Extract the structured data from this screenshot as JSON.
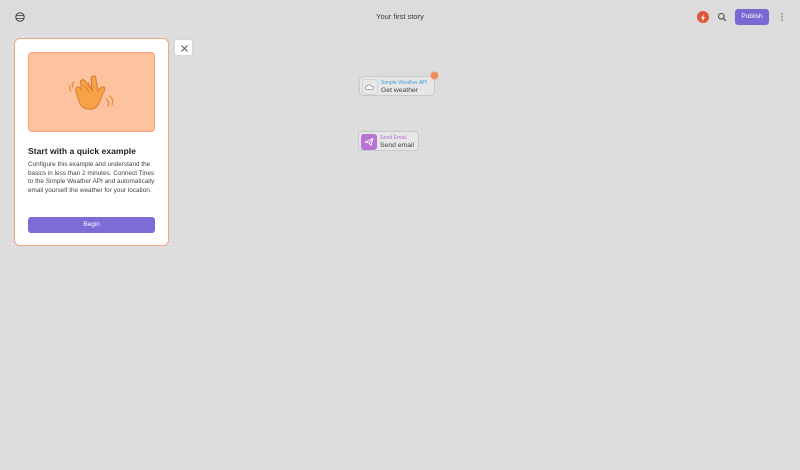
{
  "header": {
    "story_title": "Your first story",
    "publish_label": "Publish"
  },
  "modal": {
    "title": "Start with a quick example",
    "body": "Configure this example and understand the basics in less than 2 minutes. Connect Tines to the Simple Weather API and automatically email yourself the weather for your location.",
    "begin_label": "Begin",
    "hero_icon": "waving-hand-icon"
  },
  "nodes": [
    {
      "type": "Simple Weather API",
      "name": "Get weather",
      "icon": "cloud-icon"
    },
    {
      "type": "Send Email",
      "name": "Send email",
      "icon": "paper-plane-icon"
    }
  ],
  "colors": {
    "accent": "#7c68d4",
    "modal_border": "#f3a78a",
    "hero_bg": "#fdc29e",
    "weather_type": "#4aa0d6",
    "email_type": "#b472d0",
    "email_icon_bg": "#b872d4",
    "badge": "#e88c5e"
  }
}
